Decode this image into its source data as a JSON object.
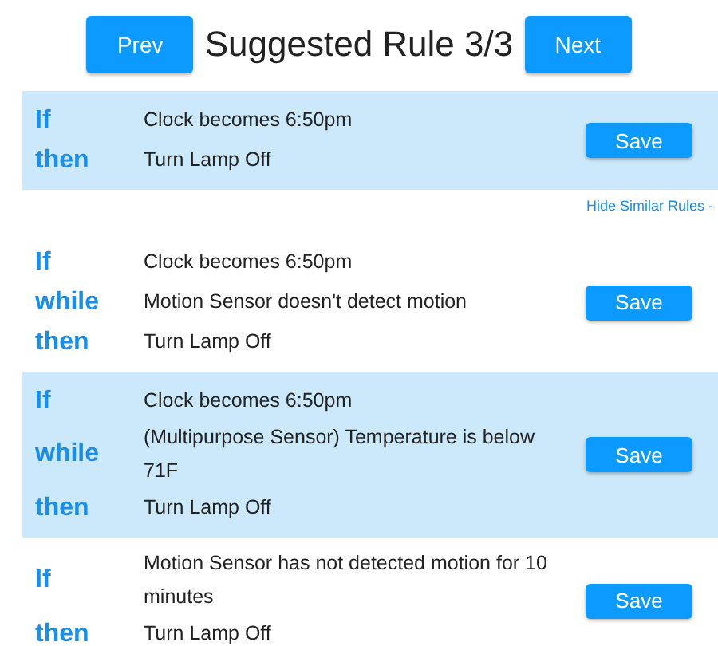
{
  "header": {
    "prev_button": "Prev",
    "title": "Suggested Rule 3/3",
    "next_button": "Next"
  },
  "rules": [
    {
      "highlighted": true,
      "clauses": [
        {
          "keyword": "If",
          "text": "Clock becomes 6:50pm"
        },
        {
          "keyword": "then",
          "text": "Turn Lamp Off"
        }
      ],
      "save_button": "Save",
      "similar_toggle": "Hide Similar Rules -"
    },
    {
      "highlighted": false,
      "clauses": [
        {
          "keyword": "If",
          "text": "Clock becomes 6:50pm"
        },
        {
          "keyword": "while",
          "text": "Motion Sensor doesn't detect motion"
        },
        {
          "keyword": "then",
          "text": "Turn Lamp Off"
        }
      ],
      "save_button": "Save"
    },
    {
      "highlighted": true,
      "clauses": [
        {
          "keyword": "If",
          "text": "Clock becomes 6:50pm"
        },
        {
          "keyword": "while",
          "text": "(Multipurpose Sensor) Temperature is below 71F"
        },
        {
          "keyword": "then",
          "text": "Turn Lamp Off"
        }
      ],
      "save_button": "Save"
    },
    {
      "highlighted": false,
      "clauses": [
        {
          "keyword": "If",
          "text": "Motion Sensor has not detected motion for 10 minutes"
        },
        {
          "keyword": "then",
          "text": "Turn Lamp Off"
        }
      ],
      "save_button": "Save"
    }
  ]
}
